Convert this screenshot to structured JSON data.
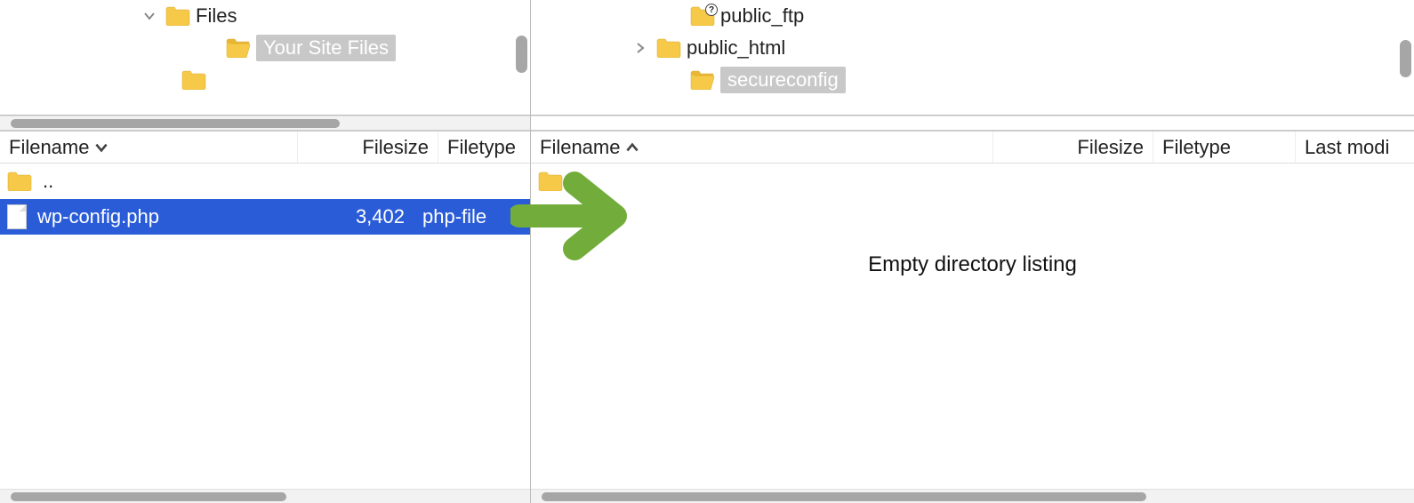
{
  "left": {
    "tree": [
      {
        "indent": 160,
        "chevron": "down",
        "folderOpen": false,
        "label": "Files",
        "highlighted": false
      },
      {
        "indent": 230,
        "chevron": "",
        "folderOpen": true,
        "label": "Your Site Files",
        "highlighted": true
      },
      {
        "indent": 180,
        "chevron": "",
        "folderOpen": false,
        "label": "",
        "highlighted": false
      }
    ],
    "columns": {
      "filename": "Filename",
      "filesize": "Filesize",
      "filetype": "Filetype"
    },
    "sortDir": "down",
    "rows": [
      {
        "type": "parent",
        "name": ".."
      },
      {
        "type": "file",
        "name": "wp-config.php",
        "size": "3,402",
        "filetype": "php-file",
        "selected": true
      }
    ]
  },
  "right": {
    "tree": [
      {
        "indent": 155,
        "chevron": "",
        "folderOpen": false,
        "badge": "?",
        "label": "public_ftp",
        "highlighted": false
      },
      {
        "indent": 115,
        "chevron": "right",
        "folderOpen": false,
        "label": "public_html",
        "highlighted": false
      },
      {
        "indent": 155,
        "chevron": "",
        "folderOpen": true,
        "label": "secureconfig",
        "highlighted": true
      }
    ],
    "columns": {
      "filename": "Filename",
      "filesize": "Filesize",
      "filetype": "Filetype",
      "lastmod": "Last modi"
    },
    "sortDir": "up",
    "rows": [
      {
        "type": "parent",
        "name": ".."
      }
    ],
    "emptyMsg": "Empty directory listing"
  }
}
